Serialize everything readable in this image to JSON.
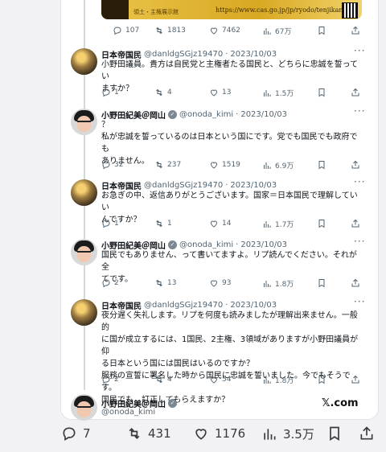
{
  "banner": {
    "url": "https://www.cas.go.jp/jp/ryodo/tenjikan",
    "caption": "領土・主権展示館"
  },
  "tweet0": {
    "stats": {
      "replies": "107",
      "retweets": "1813",
      "likes": "7462",
      "views": "67万"
    }
  },
  "tweets": [
    {
      "name": "日本帝国民",
      "handle": "@danldgSGjz19470",
      "date": "2023/10/03",
      "lines": [
        "小野田議員。貴方は自民党と主権者たる国民と、どちらに忠誠を誓ってい",
        "ますか？"
      ],
      "stats": {
        "replies": "1",
        "retweets": "4",
        "likes": "13",
        "views": "1.5万"
      }
    },
    {
      "name": "小野田紀美＠岡山",
      "handle": "@onoda_kimi",
      "date": "2023/10/03",
      "lines": [
        "？",
        "私が忠誠を誓っているのは日本という国にです。党でも国民でも政府でも",
        "ありません。"
      ],
      "stats": {
        "replies": "32",
        "retweets": "237",
        "likes": "1519",
        "views": "6.9万"
      }
    },
    {
      "name": "日本帝国民",
      "handle": "@danldgSGjz19470",
      "date": "2023/10/03",
      "lines": [
        "お急ぎの中、返信ありがとうございます。国家＝日本国民で理解していい",
        "んですか？"
      ],
      "stats": {
        "replies": "1",
        "retweets": "1",
        "likes": "14",
        "views": "1.7万"
      }
    },
    {
      "name": "小野田紀美＠岡山",
      "handle": "@onoda_kimi",
      "date": "2023/10/03",
      "lines": [
        "国民でもありません、って書いてますよ。リプ読んでください。それが全",
        "てです。"
      ],
      "stats": {
        "replies": "2",
        "retweets": "13",
        "likes": "93",
        "views": "1.8万"
      }
    },
    {
      "name": "日本帝国民",
      "handle": "@danldgSGjz19470",
      "date": "2023/10/03",
      "lines": [
        "夜分遅く失礼します。リプを何度も読みましたが理解出来ません。一般的",
        "に国が成立するには、1国民、2主権、3領域がありますが小野田議員が仰",
        "る日本という国には国民はいるのですか？",
        "服務の宣誓に署名した時から国民に忠誠を誓いました。今でもそうです。",
        "国民でも…訂正してもらえますか？"
      ],
      "stats": {
        "replies": "2",
        "retweets": "4",
        "likes": "54",
        "views": "1.8万"
      }
    }
  ],
  "last": {
    "name": "小野田紀美＠岡山",
    "handle": "@onoda_kimi",
    "xlogo": "𝕏.com"
  },
  "bottom": {
    "replies": "7",
    "retweets": "431",
    "likes": "1176",
    "views": "3.5万"
  },
  "colors": {
    "icon_gray": "#536471",
    "text": "#0f1419",
    "line": "#cfd9de"
  }
}
